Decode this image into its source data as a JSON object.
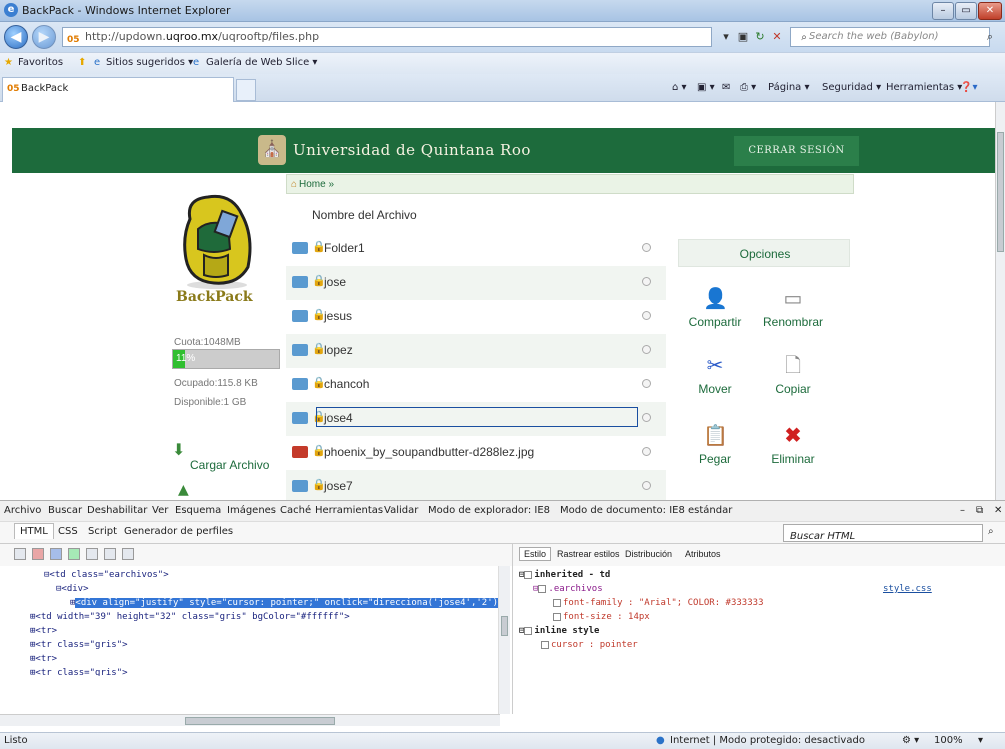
{
  "window": {
    "title": "BackPack - Windows Internet Explorer"
  },
  "address": {
    "url_pre": "http://updown.",
    "url_host": "uqroo.mx",
    "url_post": "/uqrooftp/files.php",
    "favicon": "05",
    "search_placeholder": "Search the web (Babylon)"
  },
  "favorites": {
    "label": "Favoritos",
    "sites": "Sitios sugeridos ▾",
    "gallery": "Galería de Web Slice ▾"
  },
  "tab": {
    "favicon": "05",
    "label": "BackPack"
  },
  "command_bar": {
    "page": "Página ▾",
    "security": "Seguridad ▾",
    "tools": "Herramientas ▾"
  },
  "site": {
    "university": "Universidad de Quintana Roo",
    "logout": "CERRAR SESIÓN",
    "logo_text": "BackPack",
    "quota": "Cuota:1048MB",
    "quota_pct": "11%",
    "quota_fraction": 0.11,
    "used": "Ocupado:115.8 KB",
    "available": "Disponible:1 GB",
    "upload": "Cargar Archivo",
    "breadcrumb": "Home »",
    "file_column": "Nombre del Archivo",
    "files": [
      {
        "name": "Folder1",
        "type": "folder"
      },
      {
        "name": "jose",
        "type": "folder"
      },
      {
        "name": "jesus",
        "type": "folder"
      },
      {
        "name": "lopez",
        "type": "folder"
      },
      {
        "name": "chancoh",
        "type": "folder"
      },
      {
        "name": "jose4",
        "type": "folder"
      },
      {
        "name": "phoenix_by_soupandbutter-d288lez.jpg",
        "type": "image"
      },
      {
        "name": "jose7",
        "type": "folder"
      }
    ],
    "options_title": "Opciones",
    "options": [
      "Compartir",
      "Renombrar",
      "Mover",
      "Copiar",
      "Pegar",
      "Eliminar"
    ]
  },
  "devtools": {
    "menu": [
      "Archivo",
      "Buscar",
      "Deshabilitar",
      "Ver",
      "Esquema",
      "Imágenes",
      "Caché",
      "Herramientas",
      "Validar"
    ],
    "mode_browser": "Modo de explorador: IE8",
    "mode_doc": "Modo de documento: IE8 estándar",
    "tabs": [
      "HTML",
      "CSS",
      "Script",
      "Generador de perfiles"
    ],
    "search_placeholder": "Buscar HTML",
    "style_tabs": [
      "Estilo",
      "Rastrear estilos",
      "Distribución",
      "Atributos"
    ],
    "dom_lines": [
      "⊟<td class=\"earchivos\">",
      "⊟<div>",
      "<div align=\"justify\" style=\"cursor: pointer;\" onclick=\"direcciona('jose4','2')\">",
      "⊞<td width=\"39\" height=\"32\" class=\"gris\" bgColor=\"#ffffff\">",
      "⊞<tr>",
      "⊞<tr class=\"gris\">",
      "⊞<tr>",
      "⊞<tr class=\"gris\">"
    ],
    "style_lines": [
      "inherited - td",
      ".earchivos",
      "font-family : \"Arial\"; COLOR: #333333",
      "font-size : 14px",
      "inline style",
      "cursor : pointer"
    ],
    "style_file": "style.css"
  },
  "status": {
    "left": "Listo",
    "zone": "Internet | Modo protegido: desactivado",
    "zoom": "100%"
  }
}
